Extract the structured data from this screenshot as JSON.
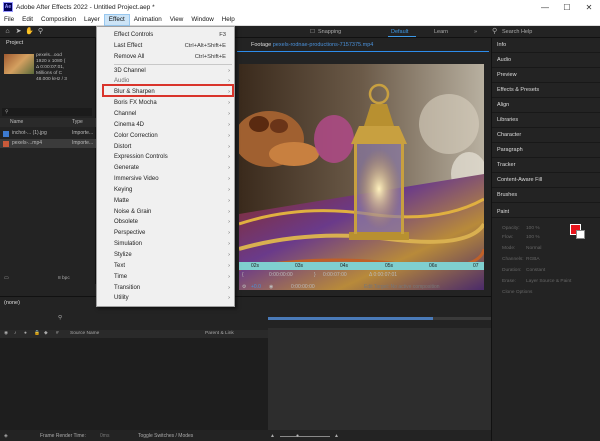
{
  "titlebar": {
    "app_badge": "Ae",
    "title": "Adobe After Effects 2022 - Untitled Project.aep *",
    "minimize": "—",
    "maximize": "☐",
    "close": "✕"
  },
  "menubar": {
    "items": [
      "File",
      "Edit",
      "Composition",
      "Layer",
      "Effect",
      "Animation",
      "View",
      "Window",
      "Help"
    ],
    "active": "Effect"
  },
  "toolbar": {
    "snapping": "Snapping",
    "workspace_default": "Default",
    "workspace_learn": "Learn",
    "search_placeholder": "Search Help"
  },
  "project_panel": {
    "tab": "Project",
    "selected_name": "pexels...ood",
    "meta_lines": [
      "1920 x 1080 (",
      "Δ 0:00:07:01,",
      "Millions of C",
      "48.000 kHz / 3"
    ],
    "columns": [
      "Name",
      "Type"
    ],
    "rows": [
      {
        "name": "inchot-... (1).jpg",
        "type": "Importe..."
      },
      {
        "name": "pexels-...mp4",
        "type": "Importe..."
      }
    ],
    "footer_bpc": "8 bpc"
  },
  "viewer": {
    "tab_label": "Footage",
    "file_name": "pexels-rodnae-productions-7157375.mp4",
    "ruler_ticks": [
      "02s",
      "03s",
      "04s",
      "05s",
      "06s",
      "07"
    ],
    "time_current": "0:00:00:00",
    "time_end": "0:00:07:00",
    "time_duration": "Δ 0:00:07:01",
    "zoom": "+0.0",
    "time_position": "0:00:00:00",
    "edit_target": "Edit Target: No active composition"
  },
  "effect_menu": {
    "items": [
      {
        "label": "Effect Controls",
        "shortcut": "F3",
        "submenu": false,
        "dim": false
      },
      {
        "label": "Last Effect",
        "shortcut": "Ctrl+Alt+Shift+E",
        "submenu": false,
        "dim": false
      },
      {
        "label": "Remove All",
        "shortcut": "Ctrl+Shift+E",
        "submenu": false,
        "dim": false
      },
      {
        "label": "3D Channel",
        "shortcut": "",
        "submenu": true,
        "dim": false
      },
      {
        "label": "Audio",
        "shortcut": "",
        "submenu": true,
        "dim": true
      },
      {
        "label": "Blur & Sharpen",
        "shortcut": "",
        "submenu": true,
        "dim": false
      },
      {
        "label": "Boris FX Mocha",
        "shortcut": "",
        "submenu": true,
        "dim": false
      },
      {
        "label": "Channel",
        "shortcut": "",
        "submenu": true,
        "dim": false
      },
      {
        "label": "Cinema 4D",
        "shortcut": "",
        "submenu": true,
        "dim": false
      },
      {
        "label": "Color Correction",
        "shortcut": "",
        "submenu": true,
        "dim": false
      },
      {
        "label": "Distort",
        "shortcut": "",
        "submenu": true,
        "dim": false
      },
      {
        "label": "Expression Controls",
        "shortcut": "",
        "submenu": true,
        "dim": false
      },
      {
        "label": "Generate",
        "shortcut": "",
        "submenu": true,
        "dim": false
      },
      {
        "label": "Immersive Video",
        "shortcut": "",
        "submenu": true,
        "dim": false
      },
      {
        "label": "Keying",
        "shortcut": "",
        "submenu": true,
        "dim": false
      },
      {
        "label": "Matte",
        "shortcut": "",
        "submenu": true,
        "dim": false
      },
      {
        "label": "Noise & Grain",
        "shortcut": "",
        "submenu": true,
        "dim": false
      },
      {
        "label": "Obsolete",
        "shortcut": "",
        "submenu": true,
        "dim": false
      },
      {
        "label": "Perspective",
        "shortcut": "",
        "submenu": true,
        "dim": false
      },
      {
        "label": "Simulation",
        "shortcut": "",
        "submenu": true,
        "dim": false
      },
      {
        "label": "Stylize",
        "shortcut": "",
        "submenu": true,
        "dim": false
      },
      {
        "label": "Text",
        "shortcut": "",
        "submenu": true,
        "dim": false
      },
      {
        "label": "Time",
        "shortcut": "",
        "submenu": true,
        "dim": false
      },
      {
        "label": "Transition",
        "shortcut": "",
        "submenu": true,
        "dim": false
      },
      {
        "label": "Utility",
        "shortcut": "",
        "submenu": true,
        "dim": false
      }
    ],
    "highlighted": "Blur & Sharpen"
  },
  "right_panel": {
    "panels": [
      "Info",
      "Audio",
      "Preview",
      "Effects & Presets",
      "Align",
      "Libraries",
      "Character",
      "Paragraph",
      "Tracker",
      "Content-Aware Fill",
      "Brushes"
    ],
    "paint_title": "Paint",
    "paint_rows": [
      "Opacity:",
      "Flow:",
      "Mode:",
      "Channels:",
      "Duration:",
      "Erase:",
      "Clone Options"
    ],
    "paint_values": [
      "100 %",
      "100 %",
      "Normal",
      "RGBA",
      "Constant",
      "Layer Source & Paint"
    ],
    "fg_color": "#e8131b",
    "bg_color": "#ffffff"
  },
  "timeline": {
    "tab": "(none)",
    "columns": [
      "Source Name",
      "Parent & Link"
    ],
    "footer_render": "Frame Render Time:",
    "footer_render_value": "0ms",
    "footer_toggle": "Toggle Switches / Modes"
  },
  "colors": {
    "accent_blue": "#2d8ceb",
    "highlight_red": "#d9342b",
    "timebar_teal": "#7fcfcf"
  }
}
